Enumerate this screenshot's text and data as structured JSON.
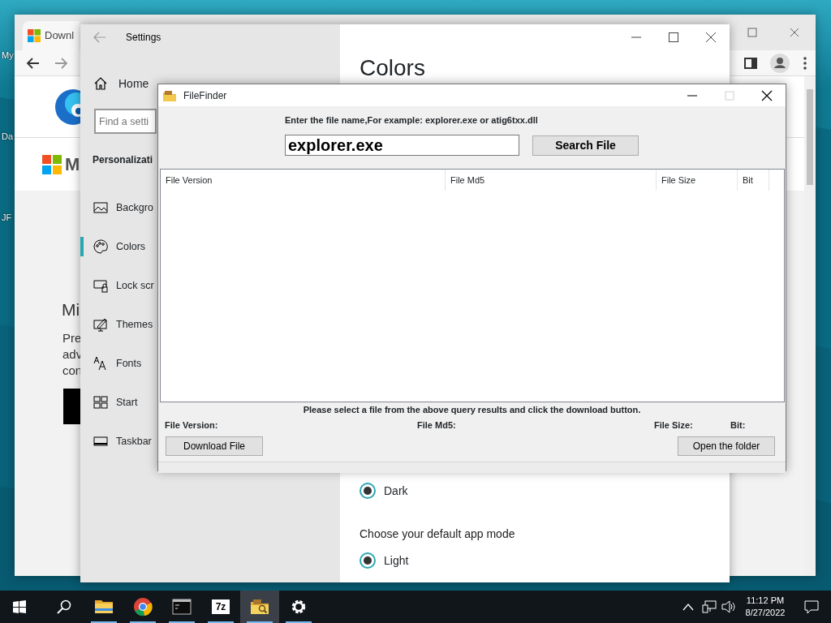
{
  "desktop": {
    "icon_labels": [
      "My",
      "Da",
      "JF"
    ]
  },
  "browser": {
    "tab_title": "Downl",
    "logo_text": "M",
    "heading": "Mi",
    "paragraph_lines": [
      "Pre",
      "adv",
      "con"
    ]
  },
  "settings": {
    "title": "Settings",
    "home": "Home",
    "search": {
      "placeholder": "Find a setti"
    },
    "section": "Personalizati",
    "nav": [
      {
        "label": "Backgro",
        "selected": false
      },
      {
        "label": "Colors",
        "selected": true
      },
      {
        "label": "Lock scr",
        "selected": false
      },
      {
        "label": "Themes",
        "selected": false
      },
      {
        "label": "Fonts",
        "selected": false
      },
      {
        "label": "Start",
        "selected": false
      },
      {
        "label": "Taskbar",
        "selected": false
      }
    ],
    "heading": "Colors",
    "windows_mode_option": {
      "label": "Dark",
      "selected": true
    },
    "app_mode": {
      "label": "Choose your default app mode",
      "options": [
        {
          "label": "Light",
          "selected": true
        }
      ]
    }
  },
  "file_finder": {
    "title": "FileFinder",
    "maximize_disabled": true,
    "prompt": "Enter the file name,For example: explorer.exe or atig6txx.dll",
    "file_name": "explorer.exe",
    "search_button": "Search File",
    "columns": [
      "File Version",
      "File Md5",
      "File Size",
      "Bit"
    ],
    "instruction": "Please select a file from the above query results and click the download button.",
    "details": [
      "File Version:",
      "File Md5:",
      "File Size:",
      "Bit:"
    ],
    "download_button": "Download File",
    "open_folder_button": "Open the folder"
  },
  "taskbar": {
    "apps": [
      {
        "running": true,
        "active": false
      },
      {
        "running": true,
        "active": false
      },
      {
        "running": true,
        "active": false
      },
      {
        "running": true,
        "active": false,
        "icon_text": "7z"
      },
      {
        "running": true,
        "active": true
      },
      {
        "running": true,
        "active": false
      }
    ],
    "time": "11:12 PM",
    "date": "8/27/2022"
  }
}
